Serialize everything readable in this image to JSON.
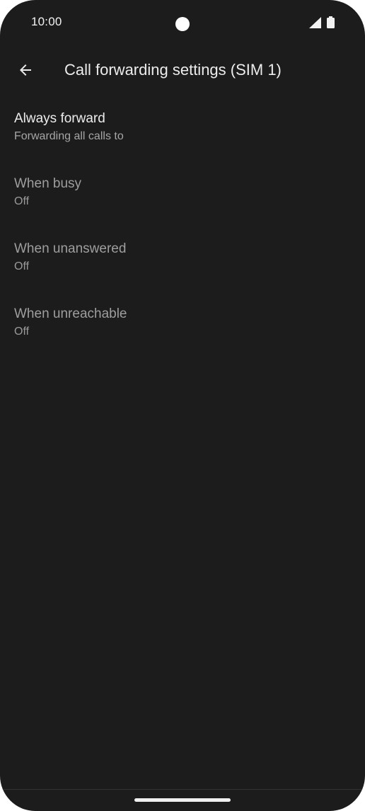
{
  "status_bar": {
    "time": "10:00",
    "icons": [
      "camera-cutout",
      "cell-signal-icon",
      "battery-icon"
    ]
  },
  "app_bar": {
    "back_icon": "arrow-back-icon",
    "title": "Call forwarding settings (SIM 1)"
  },
  "settings": {
    "items": [
      {
        "title": "Always forward",
        "summary": "Forwarding all calls to",
        "enabled": true
      },
      {
        "title": "When busy",
        "summary": "Off",
        "enabled": false
      },
      {
        "title": "When unanswered",
        "summary": "Off",
        "enabled": false
      },
      {
        "title": "When unreachable",
        "summary": "Off",
        "enabled": false
      }
    ]
  },
  "theme": {
    "background": "#1c1c1c",
    "primary_text": "#ececec",
    "secondary_text": "#a6a6a6"
  }
}
